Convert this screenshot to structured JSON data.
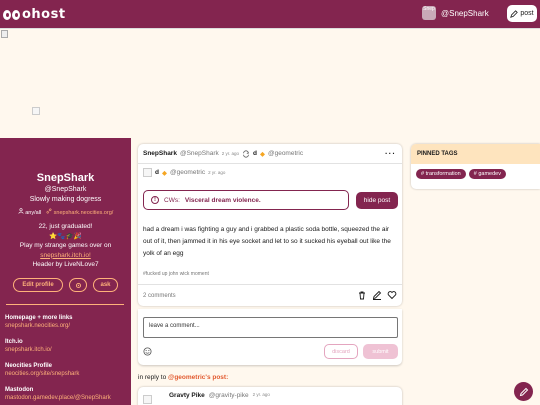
{
  "topbar": {
    "logo_text": "ohost",
    "avatar_alt": "Snep",
    "handle": "@SnepShark",
    "post_label": "post"
  },
  "sidebar": {
    "display_name": "SnepShark",
    "handle": "@SnepShark",
    "tagline": "Slowly making dogress",
    "pronouns": "any/all",
    "website": "snepshark.neocities.org/",
    "bio_line1": "22, just graduated!",
    "bio_emoji": "⭐🐾🎓🎉",
    "bio_line2": "Play my strange games over on",
    "bio_link": "snepshark.itch.io!",
    "bio_line3": "Header by LiveNLove7",
    "edit_profile": "Edit profile",
    "ask": "ask",
    "links": [
      {
        "title": "Homepage + more links",
        "url": "snepshark.neocities.org/"
      },
      {
        "title": "Itch.io",
        "url": "snepshark.itch.io/"
      },
      {
        "title": "Neocities Profile",
        "url": "neocities.org/site/snepshark"
      },
      {
        "title": "Mastodon",
        "url": "mastodon.gamedev.place/@SnepShark"
      }
    ]
  },
  "post": {
    "author_name": "SnepShark",
    "author_handle": "@SnepShark",
    "author_time": "2 yr. ago",
    "share_name": "d",
    "share_handle": "@geometric",
    "sub_name": "d",
    "sub_handle": "@geometric",
    "sub_time": "2 yr. ago",
    "cw_label": "CWs:",
    "cw_text": "Visceral dream violence.",
    "hide_label": "hide post",
    "body": "had a dream i was fighting a guy and i grabbed a plastic soda bottle, squeezed the air out of it, then jammed it in his eye socket and let to so it sucked his eyeball out like the yolk of an egg",
    "tag": "#fucked up john wick moment",
    "comments": "2 comments"
  },
  "comment": {
    "placeholder": "leave a comment...",
    "discard": "discard",
    "submit": "submit"
  },
  "reply": {
    "prefix": "in reply to",
    "target": "@geometric's post:",
    "name": "Gravty Pike",
    "handle": "@gravity-pike",
    "time": "2 yr. ago"
  },
  "pinned": {
    "title": "PINNED TAGS",
    "tags": [
      "# transformation",
      "# gamedev"
    ]
  },
  "colors": {
    "brand": "#83254f",
    "accent": "#ffb27a",
    "background": "#fff8ee",
    "pinned_header": "#fee4be"
  }
}
